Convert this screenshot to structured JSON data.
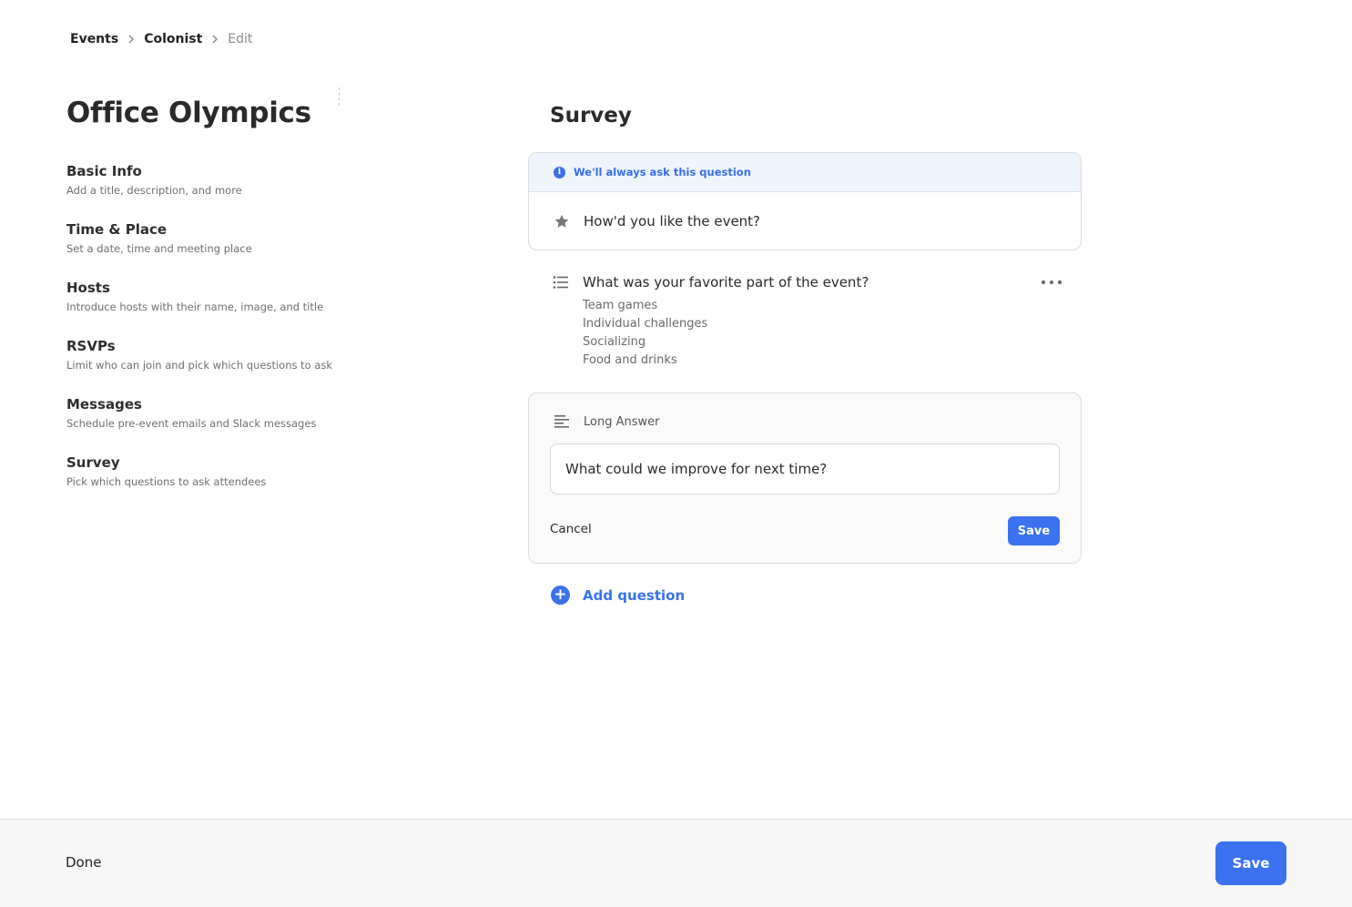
{
  "breadcrumb": {
    "items": [
      "Events",
      "Colonist",
      "Edit"
    ]
  },
  "event": {
    "title": "Office Olympics"
  },
  "sidebar": {
    "items": [
      {
        "label": "Basic Info",
        "description": "Add a title, description, and more"
      },
      {
        "label": "Time & Place",
        "description": "Set a date, time and meeting place"
      },
      {
        "label": "Hosts",
        "description": "Introduce hosts with their name, image, and title"
      },
      {
        "label": "RSVPs",
        "description": "Limit who can join and pick which questions to ask"
      },
      {
        "label": "Messages",
        "description": "Schedule pre-event emails and Slack messages"
      },
      {
        "label": "Survey",
        "description": "Pick which questions to ask attendees"
      }
    ]
  },
  "survey": {
    "title": "Survey",
    "fixed_question": {
      "banner": "We'll always ask this question",
      "icon": "star-icon",
      "text": "How'd you like the event?"
    },
    "multi_question": {
      "icon": "list-icon",
      "text": "What was your favorite part of the event?",
      "options": [
        "Team games",
        "Individual challenges",
        "Socializing",
        "Food and drinks"
      ]
    },
    "editing_question": {
      "icon": "long-answer-icon",
      "type_label": "Long Answer",
      "value": "What could we improve for next time?",
      "cancel_label": "Cancel",
      "save_label": "Save"
    },
    "add_question_label": "Add question"
  },
  "footer": {
    "done_label": "Done",
    "save_label": "Save"
  },
  "colors": {
    "accent": "#3a72f0",
    "info_banner_bg": "#eef5fd"
  }
}
